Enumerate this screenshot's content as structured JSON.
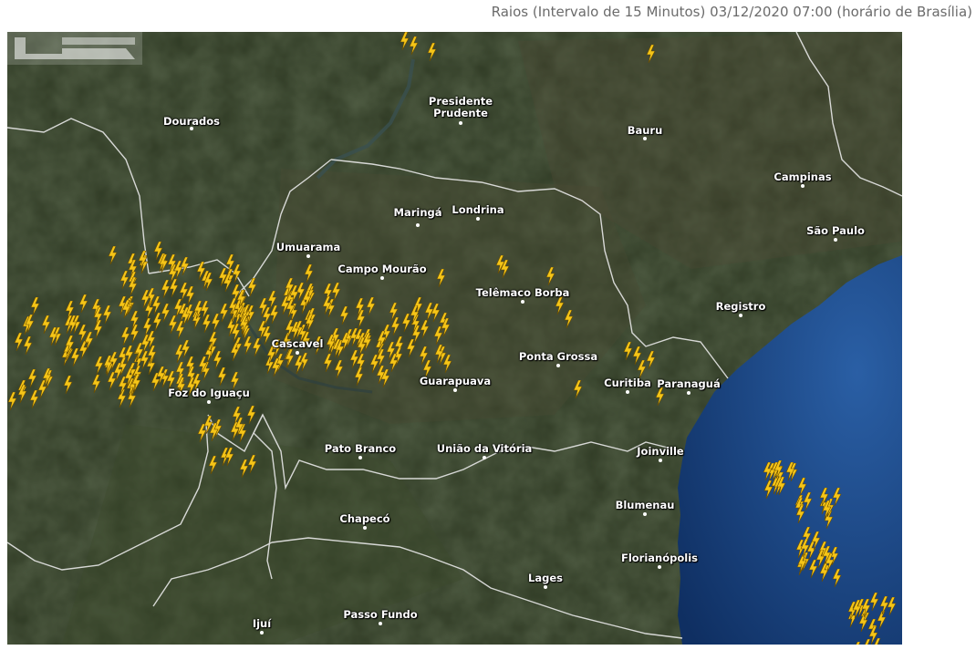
{
  "header": {
    "title": "Raios (Intervalo de 15 Minutos) 03/12/2020 07:00 (horário de Brasília)"
  },
  "colors": {
    "lightning": "#f5c518",
    "lightning_outline": "#6b4e00",
    "border": "#e8e8e8",
    "ocean": "#163f7a",
    "land": "#2e3a24"
  },
  "icons": {
    "lightning": "lightning-bolt-icon",
    "logo": "broadcaster-logo-icon"
  },
  "cities": [
    {
      "id": "dourados",
      "name": "Dourados"
    },
    {
      "id": "presidente-prudente",
      "name": "Presidente\nPrudente"
    },
    {
      "id": "bauru",
      "name": "Bauru"
    },
    {
      "id": "campinas",
      "name": "Campinas"
    },
    {
      "id": "sao-paulo",
      "name": "São Paulo"
    },
    {
      "id": "londrina",
      "name": "Londrina"
    },
    {
      "id": "maringa",
      "name": "Maringá"
    },
    {
      "id": "umuarama",
      "name": "Umuarama"
    },
    {
      "id": "campo-mourao",
      "name": "Campo Mourão"
    },
    {
      "id": "telemaco-borba",
      "name": "Telêmaco Borba"
    },
    {
      "id": "registro",
      "name": "Registro"
    },
    {
      "id": "cascavel",
      "name": "Cascavel"
    },
    {
      "id": "ponta-grossa",
      "name": "Ponta Grossa"
    },
    {
      "id": "curitiba",
      "name": "Curitiba"
    },
    {
      "id": "paranagua",
      "name": "Paranaguá"
    },
    {
      "id": "guarapuava",
      "name": "Guarapuava"
    },
    {
      "id": "foz-do-iguacu",
      "name": "Foz do Iguaçu"
    },
    {
      "id": "pato-branco",
      "name": "Pato Branco"
    },
    {
      "id": "uniao-da-vitoria",
      "name": "União da Vitória"
    },
    {
      "id": "joinville",
      "name": "Joinville"
    },
    {
      "id": "blumenau",
      "name": "Blumenau"
    },
    {
      "id": "chapeco",
      "name": "Chapecó"
    },
    {
      "id": "florianopolis",
      "name": "Florianópolis"
    },
    {
      "id": "lages",
      "name": "Lages"
    },
    {
      "id": "ijui",
      "name": "Ijuí"
    },
    {
      "id": "passo-fundo",
      "name": "Passo Fundo"
    }
  ]
}
